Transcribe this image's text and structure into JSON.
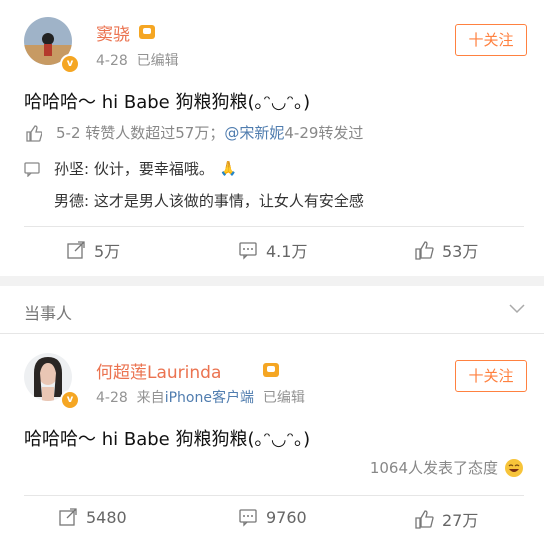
{
  "post1": {
    "username": "窦骁",
    "meta": "4-28  已编辑",
    "follow": "十关注",
    "text": "哈哈哈～ hi Babe 狗粮狗粮(｡ᵔ◡ᵔ｡)",
    "likes_info": {
      "prefix": "5-2 转赞人数超过57万；",
      "mention": "@宋新妮",
      "suffix": " 4-29转发过"
    },
    "comments": [
      {
        "user": "孙坚",
        "text": ": 伙计，要幸福哦。"
      },
      {
        "user": "男德",
        "text": ": 这才是男人该做的事情，让女人有安全感"
      }
    ],
    "actions": {
      "repost": "5万",
      "comment": "4.1万",
      "like": "53万"
    }
  },
  "section_label": "当事人",
  "post2": {
    "username": "何超莲Laurinda",
    "meta_prefix": "4-28  来自",
    "meta_source": "iPhone客户端",
    "meta_suffix": "  已编辑",
    "follow": "十关注",
    "text": "哈哈哈～ hi Babe 狗粮狗粮(｡ᵔ◡ᵔ｡)",
    "reaction_text": "1064人发表了态度",
    "actions": {
      "repost": "5480",
      "comment": "9760",
      "like": "27万"
    }
  },
  "colors": {
    "accent": "#ff8140",
    "name": "#eb7350",
    "link": "#507daf",
    "badge": "#f5a623"
  }
}
